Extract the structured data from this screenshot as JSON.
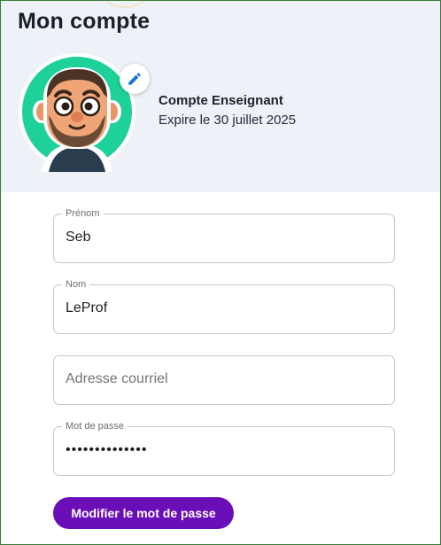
{
  "page": {
    "title": "Mon compte"
  },
  "profile": {
    "avatar_icon": "cartoon-teacher-avatar",
    "edit_icon": "pencil-icon",
    "account_type": "Compte Enseignant",
    "expiry": "Expire le 30 juillet 2025"
  },
  "form": {
    "first_name": {
      "label": "Prénom",
      "value": "Seb"
    },
    "last_name": {
      "label": "Nom",
      "value": "LeProf"
    },
    "email": {
      "placeholder": "Adresse courriel",
      "value": ""
    },
    "password": {
      "label": "Mot de passe",
      "value": "••••••••••••••"
    }
  },
  "actions": {
    "change_password_label": "Modifier le mot de passe"
  },
  "colors": {
    "header_bg": "#eef1f8",
    "avatar_bg": "#1ed199",
    "accent_blue": "#1976d2",
    "button_purple": "#6a0fb8"
  }
}
